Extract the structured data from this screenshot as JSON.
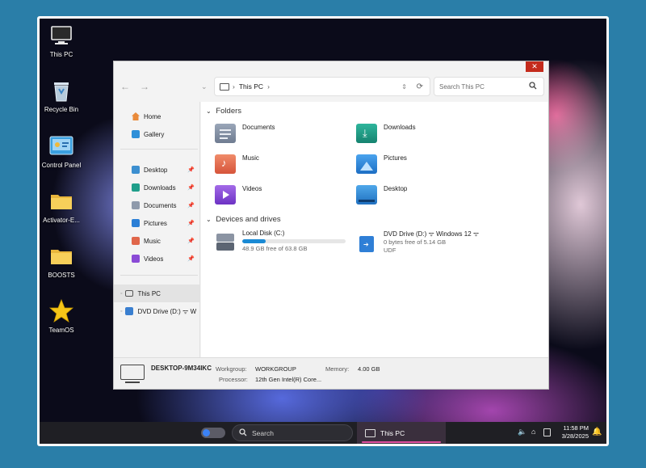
{
  "desktop": {
    "icons": [
      {
        "label": "This PC"
      },
      {
        "label": "Recycle Bin"
      },
      {
        "label": "Control Panel"
      },
      {
        "label": "Activator-E..."
      },
      {
        "label": "BOOSTS"
      },
      {
        "label": "TeamOS"
      }
    ]
  },
  "explorer": {
    "close_glyph": "✕",
    "address": {
      "path_sep1": "›",
      "path": "This PC",
      "path_sep2": "›"
    },
    "search_placeholder": "Search This PC",
    "sidebar": {
      "top": [
        {
          "label": "Home"
        },
        {
          "label": "Gallery"
        }
      ],
      "pinned": [
        {
          "label": "Desktop"
        },
        {
          "label": "Downloads"
        },
        {
          "label": "Documents"
        },
        {
          "label": "Pictures"
        },
        {
          "label": "Music"
        },
        {
          "label": "Videos"
        }
      ],
      "bottom": [
        {
          "label": "This PC"
        },
        {
          "label": "DVD Drive (D:) ᯤ W"
        }
      ]
    },
    "folders_header": "Folders",
    "folders": [
      {
        "label": "Documents"
      },
      {
        "label": "Downloads"
      },
      {
        "label": "Music"
      },
      {
        "label": "Pictures"
      },
      {
        "label": "Videos"
      },
      {
        "label": "Desktop"
      }
    ],
    "drives_header": "Devices and drives",
    "drives": [
      {
        "label": "Local Disk (C:)",
        "free": "48.9 GB free of 63.8 GB",
        "used_fraction": 0.23
      },
      {
        "label": "DVD Drive (D:) ᯤ Windows 12 ᯤ",
        "free": "0 bytes free of 5.14 GB",
        "fs": "UDF"
      }
    ],
    "details": {
      "computer_name": "DESKTOP-9M34IKC",
      "workgroup_label": "Workgroup:",
      "workgroup": "WORKGROUP",
      "memory_label": "Memory:",
      "memory": "4.00 GB",
      "processor_label": "Processor:",
      "processor": "12th Gen Intel(R) Core..."
    }
  },
  "taskbar": {
    "search_label": "Search",
    "app_label": "This PC",
    "time": "11:58 PM",
    "date": "3/28/2025"
  },
  "colors": {
    "accent": "#1a8ad4",
    "close": "#c42b1c",
    "taskbar_app_underline": "#e0509f"
  }
}
